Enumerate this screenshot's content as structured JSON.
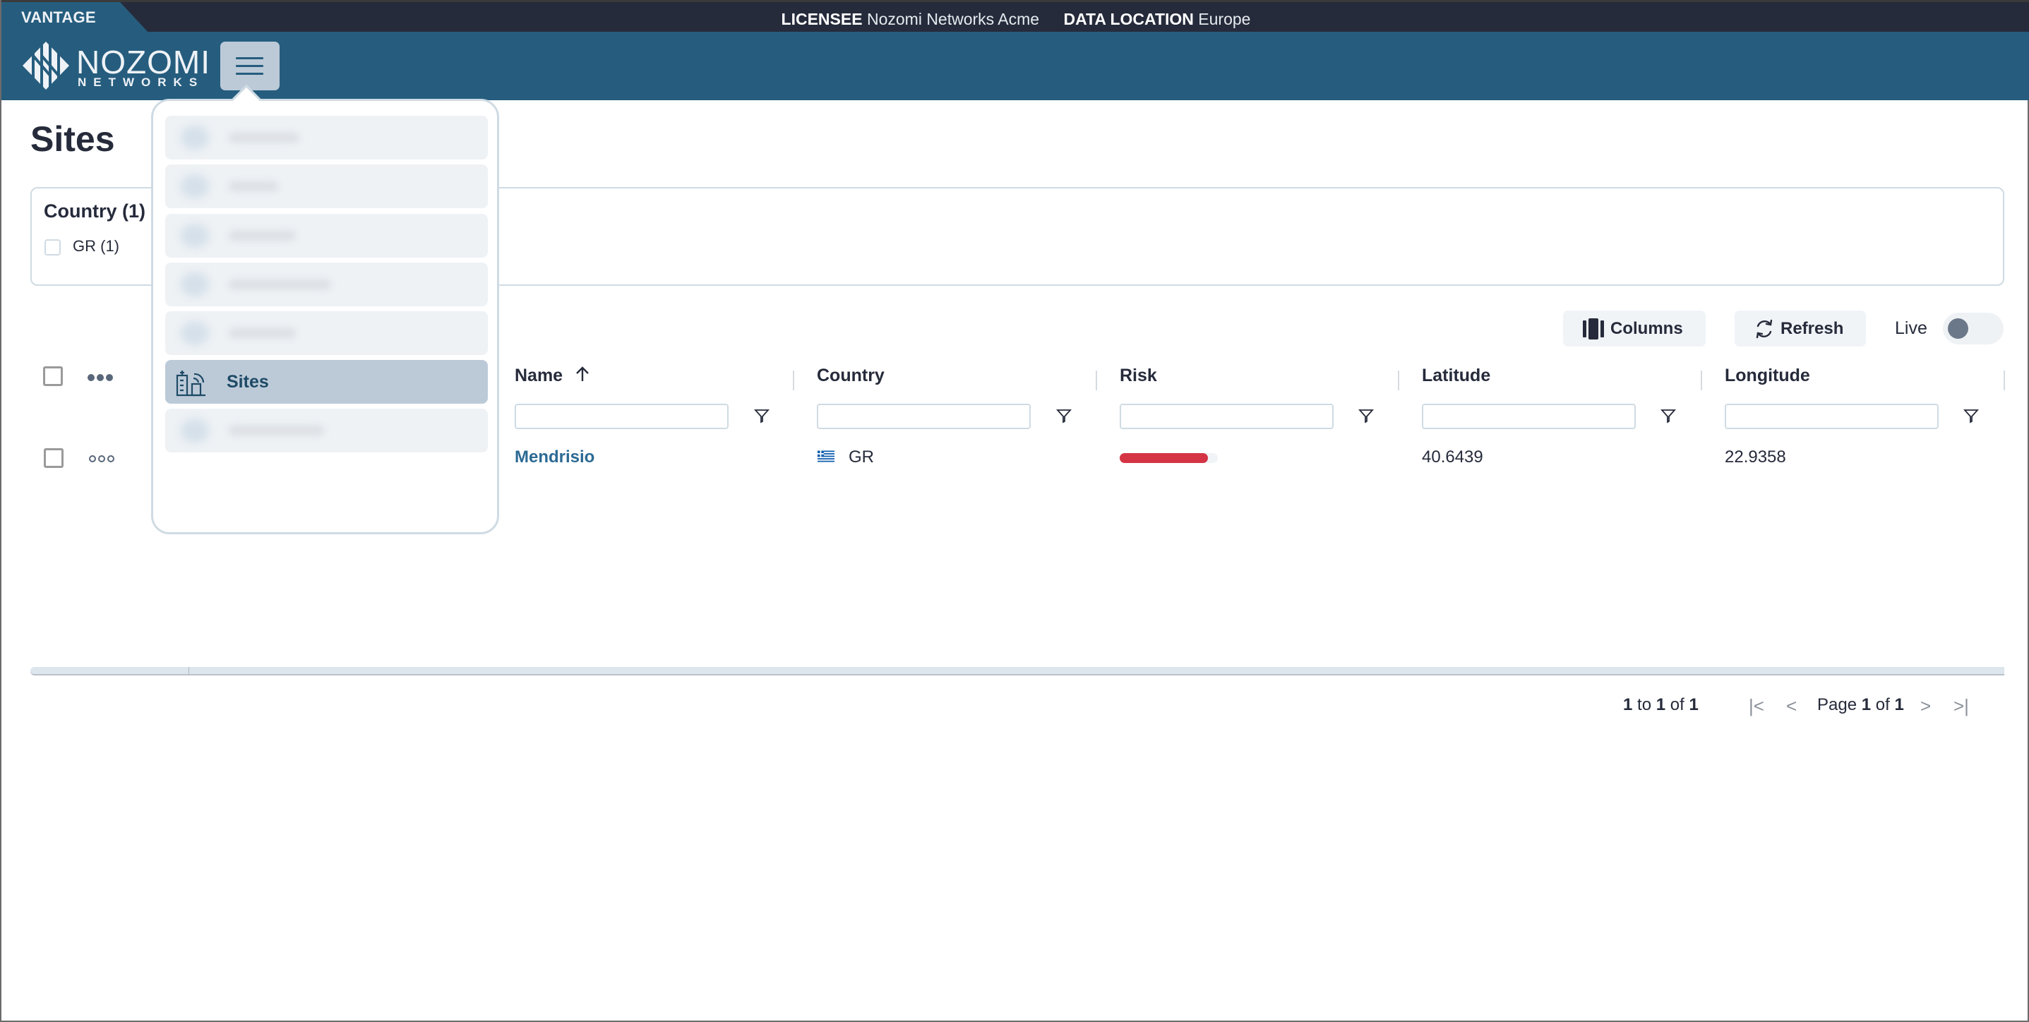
{
  "topbar": {
    "product": "VANTAGE",
    "licensee_label": "LICENSEE",
    "licensee_value": "Nozomi Networks Acme",
    "data_location_label": "DATA LOCATION",
    "data_location_value": "Europe"
  },
  "header": {
    "logo_line1": "NOZOMI",
    "logo_line2": "NETWORKS",
    "menu_button_icon": "hamburger-icon"
  },
  "nav_menu": {
    "items": [
      {
        "label": "",
        "blurred": true,
        "icon": "blurred-icon"
      },
      {
        "label": "",
        "blurred": true,
        "icon": "blurred-icon"
      },
      {
        "label": "",
        "blurred": true,
        "icon": "blurred-icon"
      },
      {
        "label": "",
        "blurred": true,
        "icon": "blurred-icon"
      },
      {
        "label": "",
        "blurred": true,
        "icon": "blurred-icon"
      },
      {
        "label": "Sites",
        "blurred": false,
        "active": true,
        "icon": "sites-building-signal-icon"
      },
      {
        "label": "",
        "blurred": true,
        "icon": "blurred-icon"
      }
    ]
  },
  "page": {
    "title": "Sites"
  },
  "facets": {
    "title": "Country (1)",
    "options": [
      {
        "label": "GR (1)",
        "checked": false
      }
    ]
  },
  "toolbar": {
    "columns_label": "Columns",
    "refresh_label": "Refresh",
    "live_label": "Live",
    "live_on": false
  },
  "table": {
    "columns": [
      {
        "key": "name",
        "label": "Name",
        "sort": "asc",
        "filter_value": ""
      },
      {
        "key": "country",
        "label": "Country",
        "filter_value": ""
      },
      {
        "key": "risk",
        "label": "Risk",
        "filter_value": ""
      },
      {
        "key": "latitude",
        "label": "Latitude",
        "filter_value": ""
      },
      {
        "key": "longitude",
        "label": "Longitude",
        "filter_value": ""
      }
    ],
    "sort_icon": "arrow-up-icon",
    "rows": [
      {
        "name": "Mendrisio",
        "country": "GR",
        "country_flag": "greece-flag-icon",
        "risk_fraction": 0.9,
        "risk_color": "#d43444",
        "latitude": "40.6439",
        "longitude": "22.9358",
        "selected": false
      }
    ]
  },
  "pagination": {
    "range_from": "1",
    "range_to_word": "to",
    "range_to": "1",
    "of_word": "of",
    "total": "1",
    "page_word": "Page",
    "page": "1",
    "page_count": "1"
  },
  "colors": {
    "topbar_bg": "#262b3b",
    "header_bg": "#265d7e",
    "accent_link": "#2c6a94",
    "risk_high": "#d43444",
    "menu_active_bg": "#bccad8"
  }
}
